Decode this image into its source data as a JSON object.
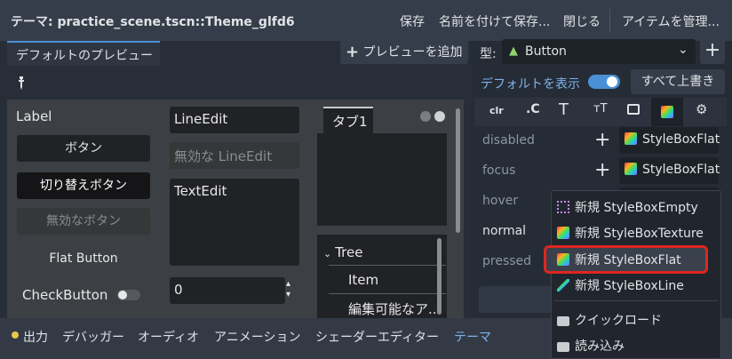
{
  "header": {
    "title": "テーマ: practice_scene.tscn::Theme_glfd6",
    "save": "保存",
    "save_as": "名前を付けて保存...",
    "close": "閉じる",
    "manage_items": "アイテムを管理..."
  },
  "preview_panel": {
    "tab_label": "デフォルトのプレビュー",
    "add_preview": "プレビューを追加",
    "picker_icon": "eyedropper-icon"
  },
  "preview": {
    "label": "Label",
    "button": "ボタン",
    "toggle_button": "切り替えボタン",
    "disabled_button": "無効なボタン",
    "flat_button": "Flat Button",
    "check_button": "CheckButton",
    "line_edit": "LineEdit",
    "disabled_line_edit": "無効な LineEdit",
    "text_edit": "TextEdit",
    "spinbox_value": "0",
    "tab1": "タブ1",
    "tree_root": "Tree",
    "tree_item": "Item",
    "tree_editable": "編集可能なア..."
  },
  "type_panel": {
    "type_label": "型:",
    "type_value": "Button",
    "show_default": "デフォルトを表示",
    "show_default_on": true,
    "override_all": "すべて上書き",
    "category_tabs": [
      "color-icon",
      "constant-icon",
      "font-icon",
      "font-size-icon",
      "icon-icon",
      "stylebox-icon",
      "type-settings-icon"
    ],
    "active_category": "stylebox-icon"
  },
  "styleboxes": [
    {
      "name": "disabled",
      "value": "StyleBoxFlat"
    },
    {
      "name": "focus",
      "value": "StyleBoxFlat"
    },
    {
      "name": "hover",
      "value": ""
    },
    {
      "name": "normal",
      "value": ""
    },
    {
      "name": "pressed",
      "value": ""
    }
  ],
  "context_menu": {
    "items": [
      {
        "label": "新規 StyleBoxEmpty",
        "icon": "stylebox-empty-icon"
      },
      {
        "label": "新規 StyleBoxTexture",
        "icon": "stylebox-texture-icon"
      },
      {
        "label": "新規 StyleBoxFlat",
        "icon": "stylebox-flat-icon",
        "highlighted": true
      },
      {
        "label": "新規 StyleBoxLine",
        "icon": "stylebox-line-icon"
      },
      {
        "label": "クイックロード",
        "icon": "folder-icon"
      },
      {
        "label": "読み込み",
        "icon": "folder-icon"
      }
    ]
  },
  "bottom_bar": {
    "output": "出力",
    "debugger": "デバッガー",
    "audio": "オーディオ",
    "animation": "アニメーション",
    "shader_editor": "シェーダーエディター",
    "theme": "テーマ"
  },
  "colors": {
    "accent": "#4a90d6",
    "highlight_border": "#e0251f",
    "output_dot": "#e8c84a"
  }
}
